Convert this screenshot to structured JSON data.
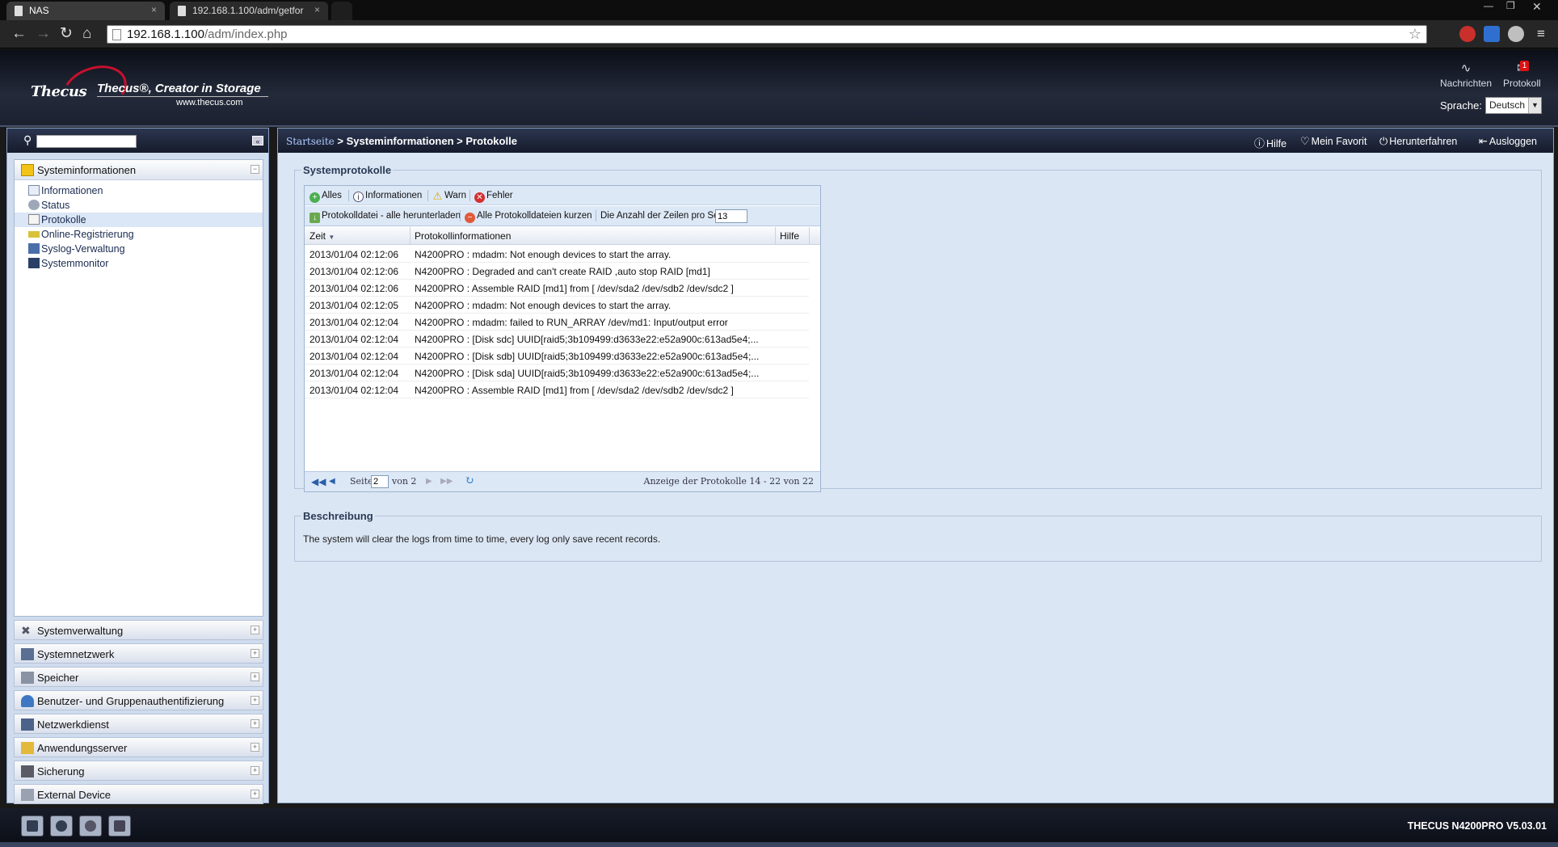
{
  "browser": {
    "tabs": [
      {
        "label": "NAS",
        "close": "×"
      },
      {
        "label": "192.168.1.100/adm/getfor",
        "close": "×"
      }
    ],
    "address": {
      "host": "192.168.1.100",
      "path": "/adm/index.php"
    }
  },
  "header": {
    "brand": "Thecus",
    "tagline": "Thecus®, Creator in Storage",
    "url": "www.thecus.com",
    "tools": [
      {
        "label": "Nachrichten",
        "icon": "rss-icon"
      },
      {
        "label": "Protokoll",
        "icon": "chat-icon",
        "badge": "1"
      }
    ],
    "language_label": "Sprache:",
    "language_value": "Deutsch"
  },
  "sidebar": {
    "search_placeholder": "",
    "open_section": {
      "label": "Systeminformationen",
      "items": [
        {
          "label": "Informationen",
          "selected": false
        },
        {
          "label": "Status",
          "selected": false
        },
        {
          "label": "Protokolle",
          "selected": true
        },
        {
          "label": "Online-Registrierung",
          "selected": false
        },
        {
          "label": "Syslog-Verwaltung",
          "selected": false
        },
        {
          "label": "Systemmonitor",
          "selected": false
        }
      ]
    },
    "sections": [
      {
        "label": "Systemverwaltung"
      },
      {
        "label": "Systemnetzwerk"
      },
      {
        "label": "Speicher"
      },
      {
        "label": "Benutzer- und Gruppenauthentifizierung"
      },
      {
        "label": "Netzwerkdienst"
      },
      {
        "label": "Anwendungsserver"
      },
      {
        "label": "Sicherung"
      },
      {
        "label": "External Device"
      }
    ]
  },
  "main": {
    "breadcrumb": {
      "home": "Startseite",
      "sep": " > ",
      "level1": "Systeminformationen",
      "level2": "Protokolle"
    },
    "actions": {
      "help": "Hilfe",
      "favorite": "Mein Favorit",
      "shutdown": "Herunterfahren",
      "logout": "Ausloggen"
    },
    "logs_title": "Systemprotokolle",
    "filters": {
      "all": "Alles",
      "info": "Informationen",
      "warn": "Warn",
      "error": "Fehler"
    },
    "toolbar2": {
      "download": "Protokolldatei - alle herunterladen",
      "truncate": "Alle Protokolldateien kurzen",
      "rows_label": "Die Anzahl der Zeilen pro Seite",
      "rows_value": "13"
    },
    "columns": {
      "time": "Zeit",
      "info": "Protokollinformationen",
      "help": "Hilfe"
    },
    "rows": [
      {
        "time": "2013/01/04 02:12:06",
        "msg": "N4200PRO : mdadm: Not enough devices to start the array."
      },
      {
        "time": "2013/01/04 02:12:06",
        "msg": "N4200PRO : Degraded and can't create RAID ,auto stop RAID [md1]"
      },
      {
        "time": "2013/01/04 02:12:06",
        "msg": "N4200PRO : Assemble RAID [md1] from [ /dev/sda2 /dev/sdb2 /dev/sdc2 ]"
      },
      {
        "time": "2013/01/04 02:12:05",
        "msg": "N4200PRO : mdadm: Not enough devices to start the array."
      },
      {
        "time": "2013/01/04 02:12:04",
        "msg": "N4200PRO : mdadm: failed to RUN_ARRAY /dev/md1: Input/output error"
      },
      {
        "time": "2013/01/04 02:12:04",
        "msg": "N4200PRO : [Disk sdc] UUID[raid5;3b109499:d3633e22:e52a900c:613ad5e4;..."
      },
      {
        "time": "2013/01/04 02:12:04",
        "msg": "N4200PRO : [Disk sdb] UUID[raid5;3b109499:d3633e22:e52a900c:613ad5e4;..."
      },
      {
        "time": "2013/01/04 02:12:04",
        "msg": "N4200PRO : [Disk sda] UUID[raid5;3b109499:d3633e22:e52a900c:613ad5e4;..."
      },
      {
        "time": "2013/01/04 02:12:04",
        "msg": "N4200PRO : Assemble RAID [md1] from [ /dev/sda2 /dev/sdb2 /dev/sdc2 ]"
      }
    ],
    "pager": {
      "page_label": "Seite",
      "page_value": "2",
      "of_label": "von 2",
      "summary": "Anzeige der Protokolle 14 - 22 von 22"
    },
    "description_title": "Beschreibung",
    "description_text": "The system will clear the logs from time to time, every log only save recent records."
  },
  "footer": {
    "product": "THECUS N4200PRO V5.03.01"
  },
  "colors": {
    "header_bg": "#1c2130",
    "panel_bg": "#dbe6f4",
    "accent_red": "#c8102e"
  }
}
